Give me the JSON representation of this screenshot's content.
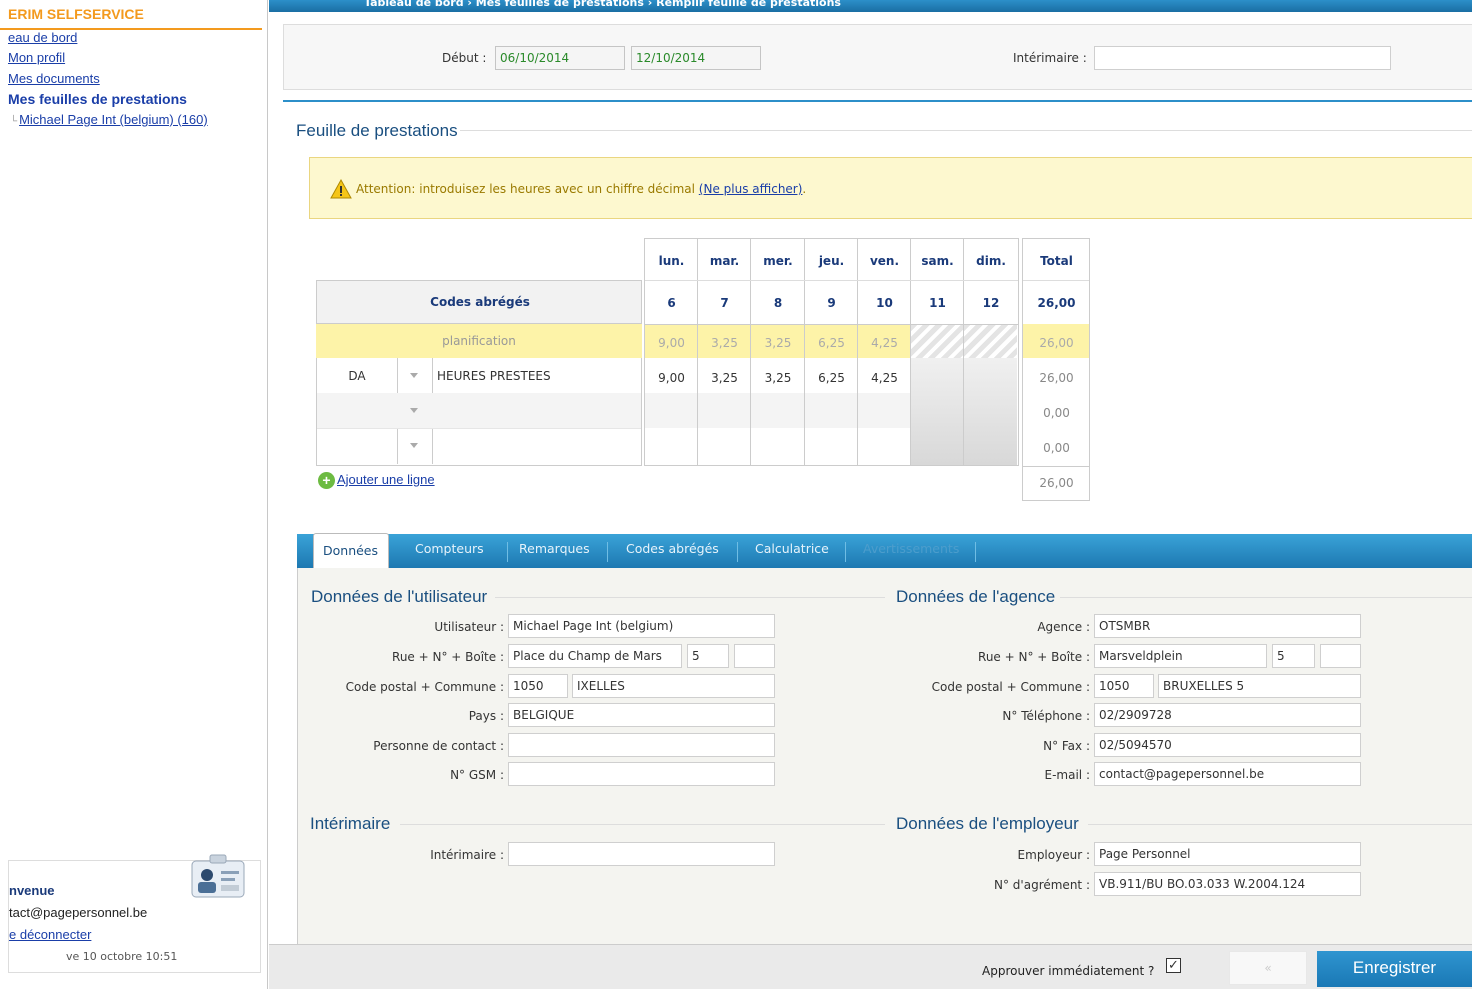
{
  "sidebar": {
    "brand": "ERIM SELFSERVICE",
    "items": [
      {
        "label": "eau de bord"
      },
      {
        "label": "Mon profil"
      },
      {
        "label": "Mes documents"
      },
      {
        "label": "Mes feuilles de prestations"
      }
    ],
    "tree_item": "Michael Page Int (belgium) (160)",
    "welcome": {
      "title": "nvenue",
      "email": "tact@pagepersonnel.be",
      "logout": "e déconnecter",
      "date": "ve 10 octobre 10:51"
    }
  },
  "header": {
    "breadcrumb": "Tableau de bord › Mes feuilles de prestations › Remplir feuille de prestations"
  },
  "filters": {
    "debut_label": "Début :",
    "date_from": "06/10/2014",
    "date_to": "12/10/2014",
    "interimaire_label": "Intérimaire :",
    "interimaire_value": ""
  },
  "sheet": {
    "title": "Feuille de prestations",
    "warning_text": "Attention: introduisez les heures avec un chiffre décimal",
    "warning_link": "(Ne plus afficher)",
    "warning_end": ".",
    "codes_header": "Codes abrégés",
    "days": [
      "lun.",
      "mar.",
      "mer.",
      "jeu.",
      "ven.",
      "sam.",
      "dim."
    ],
    "dates": [
      "6",
      "7",
      "8",
      "9",
      "10",
      "11",
      "12"
    ],
    "total_header": "Total",
    "total_value": "26,00",
    "planning": {
      "label": "planification",
      "values": [
        "9,00",
        "3,25",
        "3,25",
        "6,25",
        "4,25",
        "",
        ""
      ],
      "total": "26,00"
    },
    "rows": [
      {
        "code": "DA",
        "label": "HEURES PRESTEES",
        "values": [
          "9,00",
          "3,25",
          "3,25",
          "6,25",
          "4,25",
          "",
          ""
        ],
        "total": "26,00"
      },
      {
        "code": "",
        "label": "",
        "values": [
          "",
          "",
          "",
          "",
          "",
          "",
          ""
        ],
        "total": "0,00"
      },
      {
        "code": "",
        "label": "",
        "values": [
          "",
          "",
          "",
          "",
          "",
          "",
          ""
        ],
        "total": "0,00"
      }
    ],
    "grand_total": "26,00",
    "add_line": "Ajouter une ligne"
  },
  "tabs": [
    {
      "label": "Données",
      "active": true
    },
    {
      "label": "Compteurs"
    },
    {
      "label": "Remarques"
    },
    {
      "label": "Codes abrégés"
    },
    {
      "label": "Calculatrice"
    },
    {
      "label": "Avertissements",
      "disabled": true
    }
  ],
  "user_data": {
    "title": "Données de l'utilisateur",
    "utilisateur_label": "Utilisateur :",
    "utilisateur": "Michael Page Int (belgium)",
    "rue_label": "Rue + N° + Boîte :",
    "rue": "Place du Champ de Mars",
    "numero": "5",
    "boite": "",
    "cp_label": "Code postal + Commune :",
    "cp": "1050",
    "commune": "IXELLES",
    "pays_label": "Pays :",
    "pays": "BELGIQUE",
    "contact_label": "Personne de contact :",
    "contact": "",
    "gsm_label": "N° GSM :",
    "gsm": ""
  },
  "agency_data": {
    "title": "Données de l'agence",
    "agence_label": "Agence :",
    "agence": "OTSMBR",
    "rue_label": "Rue + N° + Boîte :",
    "rue": "Marsveldplein",
    "numero": "5",
    "boite": "",
    "cp_label": "Code postal + Commune :",
    "cp": "1050",
    "commune": "BRUXELLES 5",
    "tel_label": "N° Téléphone :",
    "tel": "02/2909728",
    "fax_label": "N° Fax :",
    "fax": "02/5094570",
    "email_label": "E-mail :",
    "email": "contact@pagepersonnel.be"
  },
  "interimaire_section": {
    "title": "Intérimaire",
    "label": "Intérimaire :",
    "value": ""
  },
  "employer_data": {
    "title": "Données de l'employeur",
    "employeur_label": "Employeur :",
    "employeur": "Page Personnel",
    "agrement_label": "N° d'agrément :",
    "agrement": "VB.911/BU BO.03.033 W.2004.124"
  },
  "footer": {
    "approve_label": "Approuver immédiatement ?",
    "approve_checked": true,
    "prev_label": "«",
    "save_label": "Enregistrer"
  },
  "colors": {
    "accent_blue": "#1d78b1",
    "brand_orange": "#f39a1e",
    "warning_bg": "#fdf8cf",
    "planning_bg": "#fdf3a8"
  }
}
